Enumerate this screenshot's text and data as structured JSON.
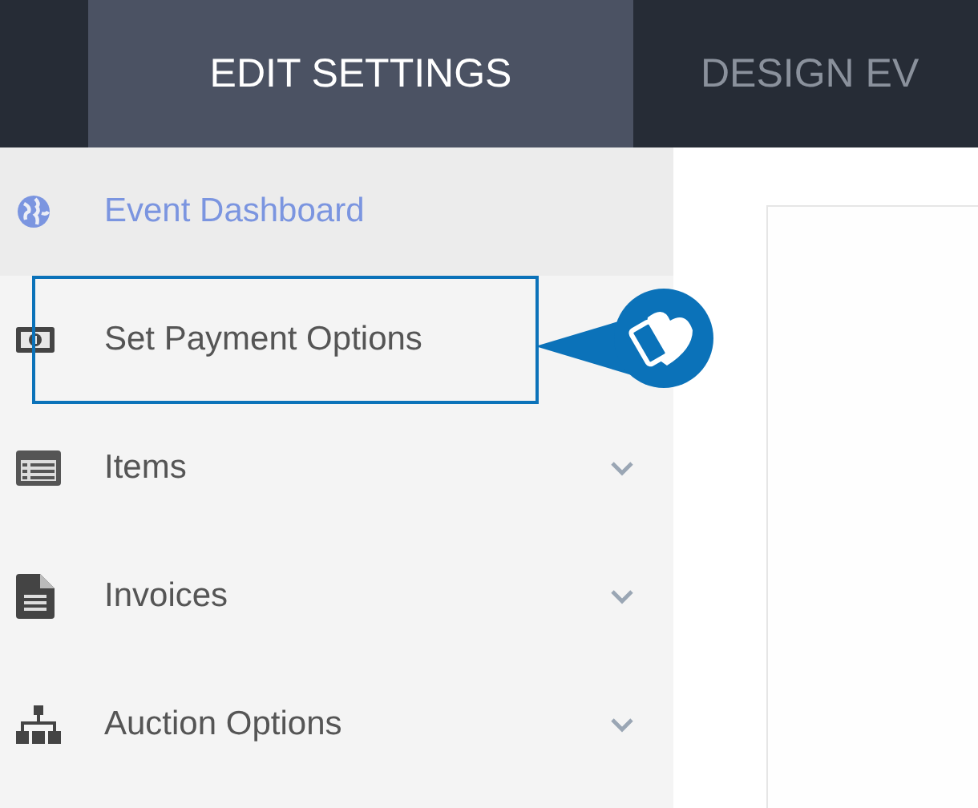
{
  "tabs": [
    {
      "label": "EDIT SETTINGS",
      "selected": true
    },
    {
      "label": "DESIGN EV",
      "selected": false
    }
  ],
  "sidebar": {
    "items": [
      {
        "label": "Event Dashboard",
        "kind": "globe",
        "selected": true,
        "highlighted": false
      },
      {
        "label": "Set Payment Options",
        "kind": "money",
        "selected": false,
        "highlighted": true
      },
      {
        "label": "Items",
        "kind": "list",
        "selected": false,
        "highlighted": false,
        "expanded": false
      },
      {
        "label": "Invoices",
        "kind": "document",
        "selected": false,
        "highlighted": false,
        "expanded": false
      },
      {
        "label": "Auction Options",
        "kind": "sitemap",
        "selected": false,
        "highlighted": false,
        "expanded": false
      }
    ]
  }
}
